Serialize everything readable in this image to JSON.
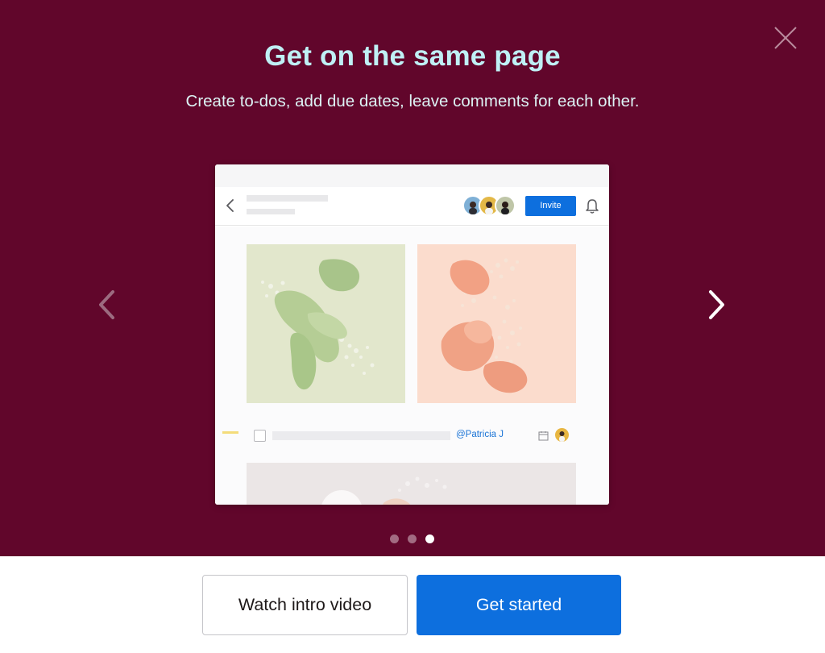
{
  "hero": {
    "title": "Get on the same page",
    "subtitle": "Create to-dos, add due dates, leave comments for each other.",
    "background_color": "#61062b",
    "title_color": "#bff0f5"
  },
  "icons": {
    "close": "close-icon",
    "prev": "chevron-left-icon",
    "next": "chevron-right-icon",
    "back": "chevron-left-icon",
    "bell": "bell-icon",
    "calendar": "calendar-icon"
  },
  "preview": {
    "invite_label": "Invite",
    "mention": "@Patricia J",
    "accent_color": "#0d6fde"
  },
  "carousel": {
    "slide_count": 3,
    "active_index": 2
  },
  "footer": {
    "watch_label": "Watch intro video",
    "start_label": "Get started"
  }
}
